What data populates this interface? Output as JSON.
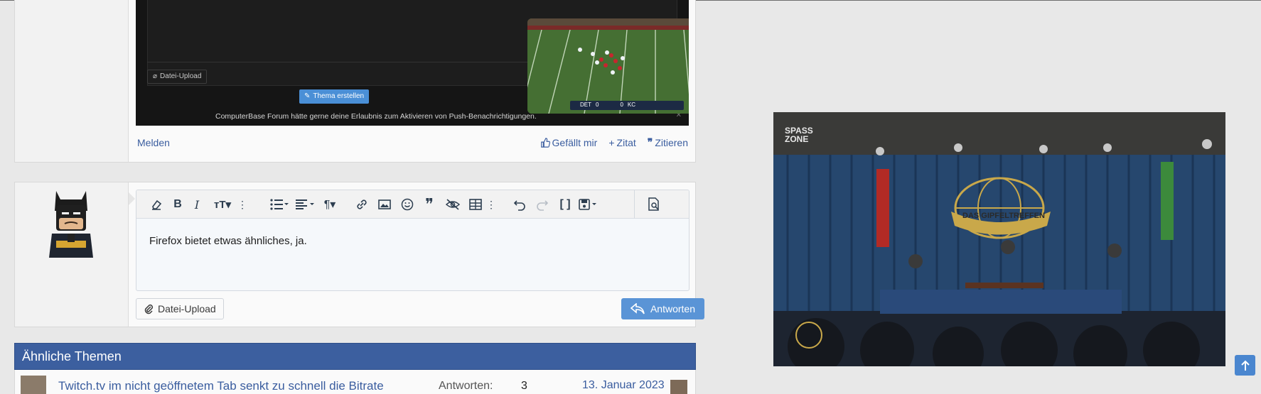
{
  "post_top": {
    "embedded_screenshot": {
      "file_upload_label": "Datei-Upload",
      "create_thread_label": "Thema erstellen",
      "push_message": "ComputerBase Forum hätte gerne deine Erlaubnis zum Aktivieren von Push-Benachrichtigungen.",
      "close_glyph": "✕",
      "score": {
        "team_a": "DET",
        "score_a": "0",
        "team_b": "KC",
        "score_b": "0"
      }
    },
    "actions": {
      "report": "Melden",
      "like": "Gefällt mir",
      "quote": "Zitat",
      "reply_quote": "Zitieren"
    }
  },
  "reply_editor": {
    "content": "Firefox bietet etwas ähnliches, ja.",
    "file_upload_label": "Datei-Upload",
    "submit_label": "Antworten",
    "toolbar_icons": [
      "eraser-icon",
      "bold-icon",
      "italic-icon",
      "font-size-icon",
      "more-icon",
      "list-icon",
      "align-icon",
      "paragraph-icon",
      "link-icon",
      "image-icon",
      "smilie-icon",
      "quote-icon",
      "hide-icon",
      "table-icon",
      "more-icon",
      "undo-icon",
      "redo-icon",
      "code-icon",
      "drafts-icon",
      "preview-icon"
    ]
  },
  "similar_threads": {
    "header": "Ähnliche Themen",
    "rows": [
      {
        "title": "Twitch.tv im nicht geöffnetem Tab senkt zu schnell die Bitrate",
        "replies_label": "Antworten:",
        "replies": "3",
        "date": "13. Januar 2023"
      }
    ]
  },
  "video_right": {
    "logo_text": "SPASS ZONE",
    "sign_text": "DAS GIPFELTREFFEN"
  },
  "colors": {
    "accent": "#3c5f9f",
    "button": "#5a94d6",
    "link": "#3a5d9f"
  }
}
